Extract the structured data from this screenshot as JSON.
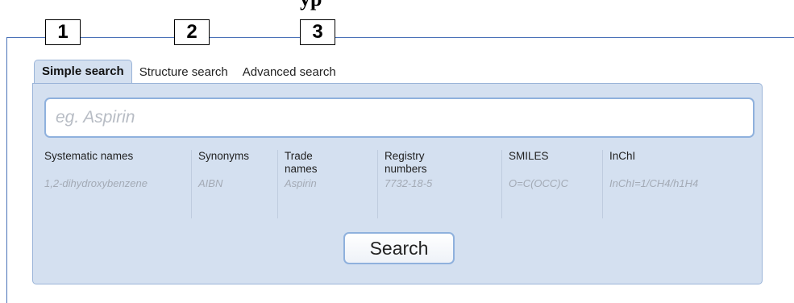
{
  "heading_fragment": "ур",
  "labels": [
    "1",
    "2",
    "3"
  ],
  "tabs": [
    {
      "label": "Simple search",
      "active": true
    },
    {
      "label": "Structure search",
      "active": false
    },
    {
      "label": "Advanced search",
      "active": false
    }
  ],
  "search": {
    "placeholder": "eg. Aspirin",
    "value": ""
  },
  "columns": [
    {
      "header": "Systematic names",
      "example": "1,2-dihydroxybenzene"
    },
    {
      "header": "Synonyms",
      "example": "AIBN"
    },
    {
      "header": "Trade names",
      "example": "Aspirin"
    },
    {
      "header": "Registry numbers",
      "example": "7732-18-5"
    },
    {
      "header": "SMILES",
      "example": "O=C(OCC)C"
    },
    {
      "header": "InChI",
      "example": "InChI=1/CH4/h1H4"
    }
  ],
  "search_button": "Search",
  "colors": {
    "accent_border": "#8fb1dd",
    "panel_bg": "#d4e0f0",
    "frame_line": "#4a72b8"
  }
}
